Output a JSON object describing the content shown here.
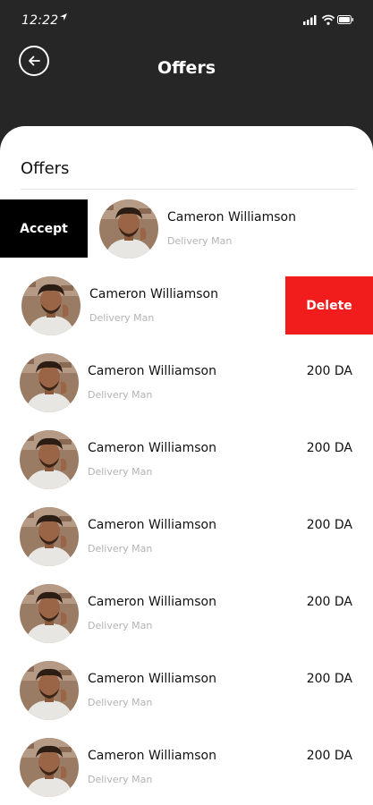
{
  "status_bar": {
    "time": "12:22",
    "icons": [
      "location-arrow-icon",
      "signal-icon",
      "wifi-icon",
      "battery-icon"
    ]
  },
  "header": {
    "title": "Offers",
    "back_icon": "arrow-left-icon",
    "background": "#262626"
  },
  "section": {
    "title": "Offers"
  },
  "actions": {
    "accept_label": "Accept",
    "delete_label": "Delete",
    "accept_color": "#000000",
    "delete_color": "#F11C1C"
  },
  "offers": [
    {
      "name": "Cameron Williamson",
      "role": "Delivery Man",
      "price": "",
      "state": "swiped-right"
    },
    {
      "name": "Cameron Williamson",
      "role": "Delivery Man",
      "price": "",
      "state": "swiped-left"
    },
    {
      "name": "Cameron Williamson",
      "role": "Delivery Man",
      "price": "200 DA",
      "state": "normal"
    },
    {
      "name": "Cameron Williamson",
      "role": "Delivery Man",
      "price": "200 DA",
      "state": "normal"
    },
    {
      "name": "Cameron Williamson",
      "role": "Delivery Man",
      "price": "200 DA",
      "state": "normal"
    },
    {
      "name": "Cameron Williamson",
      "role": "Delivery Man",
      "price": "200 DA",
      "state": "normal"
    },
    {
      "name": "Cameron Williamson",
      "role": "Delivery Man",
      "price": "200 DA",
      "state": "normal"
    },
    {
      "name": "Cameron Williamson",
      "role": "Delivery Man",
      "price": "200 DA",
      "state": "normal"
    }
  ]
}
